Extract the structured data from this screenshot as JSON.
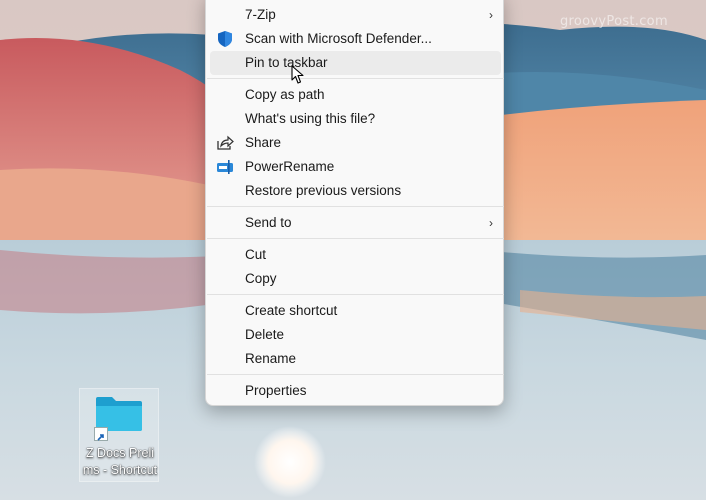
{
  "watermark": "groovyPost.com",
  "menu": {
    "items": [
      {
        "label": "7-Zip",
        "submenu": true,
        "icon": null
      },
      {
        "label": "Scan with Microsoft Defender...",
        "submenu": false,
        "icon": "defender-shield-icon"
      },
      {
        "label": "Pin to taskbar",
        "submenu": false,
        "icon": null,
        "hovered": true
      },
      {
        "label": "Copy as path",
        "submenu": false,
        "icon": null
      },
      {
        "label": "What's using this file?",
        "submenu": false,
        "icon": null
      },
      {
        "label": "Share",
        "submenu": false,
        "icon": "share-icon"
      },
      {
        "label": "PowerRename",
        "submenu": false,
        "icon": "powerrename-icon"
      },
      {
        "label": "Restore previous versions",
        "submenu": false,
        "icon": null
      },
      {
        "label": "Send to",
        "submenu": true,
        "icon": null
      },
      {
        "label": "Cut",
        "submenu": false,
        "icon": null
      },
      {
        "label": "Copy",
        "submenu": false,
        "icon": null
      },
      {
        "label": "Create shortcut",
        "submenu": false,
        "icon": null
      },
      {
        "label": "Delete",
        "submenu": false,
        "icon": null
      },
      {
        "label": "Rename",
        "submenu": false,
        "icon": null
      },
      {
        "label": "Properties",
        "submenu": false,
        "icon": null
      }
    ],
    "chevron": "›"
  },
  "desktop": {
    "icon_label_line1": "Z Docs Preli",
    "icon_label_line2": "ms - Shortcut"
  },
  "colors": {
    "menu_bg": "#f9f9f9",
    "hover_bg": "#ebebeb",
    "folder": "#2fb3d9",
    "defender": "#1565c0"
  }
}
